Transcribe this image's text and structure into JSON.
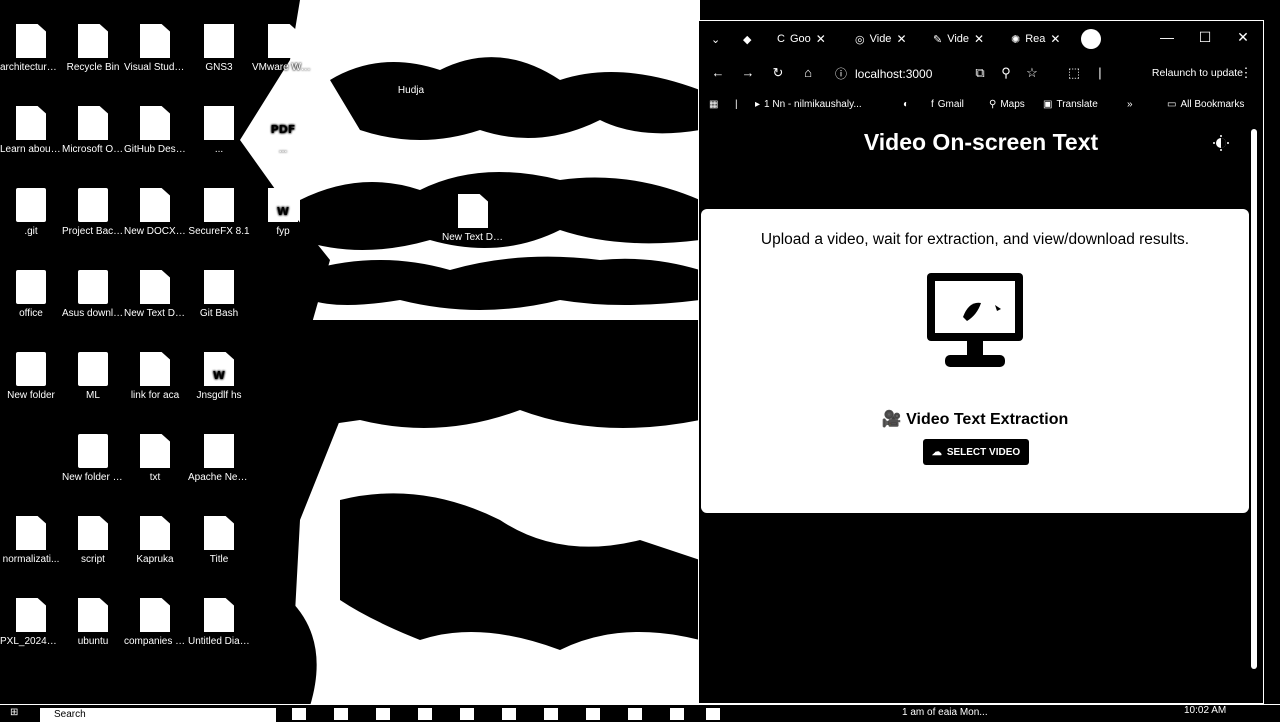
{
  "desktop": {
    "icons": [
      {
        "label": "architecture diagram.d...",
        "glyph": "file"
      },
      {
        "label": "Recycle Bin",
        "glyph": "file"
      },
      {
        "label": "Visual Studio Code",
        "glyph": "file"
      },
      {
        "label": "GNS3",
        "glyph": "dark"
      },
      {
        "label": "VMware Workstati...",
        "glyph": "file"
      },
      {
        "label": "Learn about this picture",
        "glyph": "file"
      },
      {
        "label": "Microsoft Office 2007",
        "glyph": "file"
      },
      {
        "label": "GitHub Desktop",
        "glyph": "file"
      },
      {
        "label": "...",
        "glyph": "dark"
      },
      {
        "label": "...",
        "glyph": "file",
        "mark": "PDF"
      },
      {
        "label": ".git",
        "glyph": "folder"
      },
      {
        "label": "Project Backups",
        "glyph": "folder"
      },
      {
        "label": "New DOCX Document",
        "glyph": "file"
      },
      {
        "label": "SecureFX 8.1",
        "glyph": "dark"
      },
      {
        "label": "fyp",
        "glyph": "file",
        "mark": "W"
      },
      {
        "label": "office",
        "glyph": "folder"
      },
      {
        "label": "Asus downloads",
        "glyph": "folder"
      },
      {
        "label": "New Text Document",
        "glyph": "file"
      },
      {
        "label": "Git Bash",
        "glyph": "dark"
      },
      {
        "label": "New folder",
        "glyph": "folder"
      },
      {
        "label": "ML",
        "glyph": "folder"
      },
      {
        "label": "link for aca",
        "glyph": "file"
      },
      {
        "label": "Jnsgdlf hs",
        "glyph": "file",
        "mark": "W"
      },
      {
        "label": "New folder (2)",
        "glyph": "folder"
      },
      {
        "label": "txt",
        "glyph": "file"
      },
      {
        "label": "Apache NetBeans",
        "glyph": "dark"
      },
      {
        "label": "normalizati...",
        "glyph": "file"
      },
      {
        "label": "script",
        "glyph": "file"
      },
      {
        "label": "Kapruka",
        "glyph": "file"
      },
      {
        "label": "Title",
        "glyph": "file"
      },
      {
        "label": "PXL_2024101...",
        "glyph": "file"
      },
      {
        "label": "ubuntu",
        "glyph": "file"
      },
      {
        "label": "companies roles",
        "glyph": "file"
      },
      {
        "label": "Untitled Diagram.dr...",
        "glyph": "file"
      },
      {
        "label": "Hudja",
        "glyph": "none"
      },
      {
        "label": "New Text Document (2)",
        "glyph": "file"
      }
    ]
  },
  "browser": {
    "tabs": [
      {
        "icon": "github-icon",
        "label": ""
      },
      {
        "icon": "google-icon",
        "label": "Goo"
      },
      {
        "icon": "app-icon",
        "label": "Vide"
      },
      {
        "icon": "pen-icon",
        "label": "Vide"
      },
      {
        "icon": "react-icon",
        "label": "Rea"
      }
    ],
    "url": "localhost:3000",
    "relaunch_label": "Relaunch to update",
    "bookmarks": [
      {
        "label": "1 Nn - nilmikaushaly..."
      },
      {
        "label": ""
      },
      {
        "label": "Gmail"
      },
      {
        "label": "Maps"
      },
      {
        "label": "Translate"
      }
    ],
    "all_bookmarks_label": "All Bookmarks",
    "overflow_label": "»"
  },
  "app": {
    "title": "Video On-screen Text",
    "instructions": "Upload a video, wait for extraction, and view/download results.",
    "heading": "🎥 Video Text Extraction",
    "select_button_label": "SELECT VIDEO"
  },
  "taskbar": {
    "search_placeholder": "Search",
    "weather": "1 am of eaia Mon...",
    "time": "10:02 AM"
  }
}
